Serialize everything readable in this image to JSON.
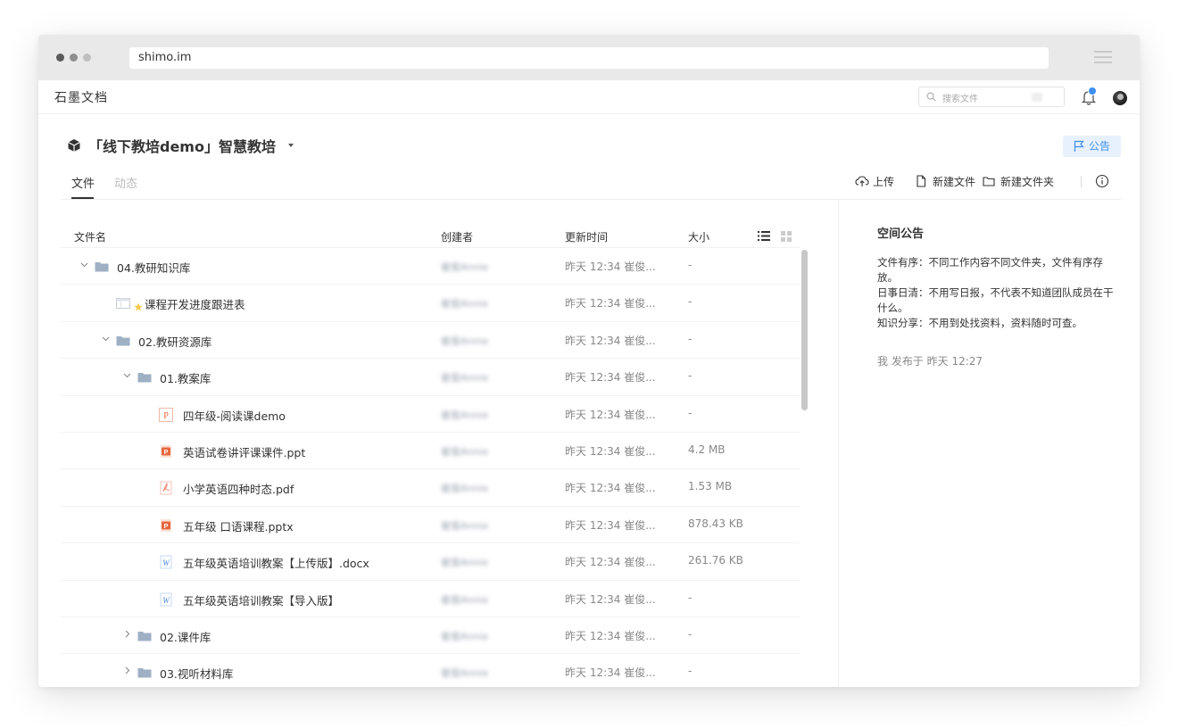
{
  "browser": {
    "url": "shimo.im"
  },
  "app": {
    "brand": "石墨文档",
    "search_placeholder": "搜索文件"
  },
  "team": {
    "title": "「线下教培demo」智慧教培",
    "announce_label": "公告"
  },
  "tabs": [
    {
      "label": "文件"
    },
    {
      "label": "动态"
    }
  ],
  "actions": {
    "upload": "上传",
    "new_file": "新建文件",
    "new_folder": "新建文件夹"
  },
  "columns": {
    "name": "文件名",
    "creator": "创建者",
    "updated": "更新时间",
    "size": "大小"
  },
  "rows": [
    {
      "name": "04.教研知识库",
      "creator": "崔俊Annie",
      "time": "昨天 12:34 崔俊...",
      "size": "-",
      "type": "folder",
      "chevron": "down",
      "depth": 0
    },
    {
      "name": "课程开发进度跟进表",
      "creator": "崔俊Annie",
      "time": "昨天 12:34 崔俊...",
      "size": "-",
      "type": "sheet",
      "chevron": "none",
      "depth": 1
    },
    {
      "name": "02.教研资源库",
      "creator": "崔俊Annie",
      "time": "昨天 12:34 崔俊...",
      "size": "-",
      "type": "folder",
      "chevron": "down",
      "depth": 1
    },
    {
      "name": "01.教案库",
      "creator": "崔俊Annie",
      "time": "昨天 12:34 崔俊...",
      "size": "-",
      "type": "folder",
      "chevron": "down",
      "depth": 2
    },
    {
      "name": "四年级-阅读课demo",
      "creator": "崔俊Annie",
      "time": "昨天 12:34 崔俊...",
      "size": "-",
      "type": "slides",
      "chevron": "none",
      "depth": 3
    },
    {
      "name": "英语试卷讲评课课件.ppt",
      "creator": "崔俊Annie",
      "time": "昨天 12:34 崔俊...",
      "size": "4.2 MB",
      "type": "ppt",
      "chevron": "none",
      "depth": 3
    },
    {
      "name": "小学英语四种时态.pdf",
      "creator": "崔俊Annie",
      "time": "昨天 12:34 崔俊...",
      "size": "1.53 MB",
      "type": "pdf",
      "chevron": "none",
      "depth": 3
    },
    {
      "name": "五年级 口语课程.pptx",
      "creator": "崔俊Annie",
      "time": "昨天 12:34 崔俊...",
      "size": "878.43 KB",
      "type": "ppt",
      "chevron": "none",
      "depth": 3
    },
    {
      "name": "五年级英语培训教案【上传版】.docx",
      "creator": "崔俊Annie",
      "time": "昨天 12:34 崔俊...",
      "size": "261.76 KB",
      "type": "word",
      "chevron": "none",
      "depth": 3
    },
    {
      "name": "五年级英语培训教案【导入版】",
      "creator": "崔俊Annie",
      "time": "昨天 12:34 崔俊...",
      "size": "-",
      "type": "word",
      "chevron": "none",
      "depth": 3
    },
    {
      "name": "02.课件库",
      "creator": "崔俊Annie",
      "time": "昨天 12:34 崔俊...",
      "size": "-",
      "type": "folder",
      "chevron": "right",
      "depth": 2
    },
    {
      "name": "03.视听材料库",
      "creator": "崔俊Annie",
      "time": "昨天 12:34 崔俊...",
      "size": "-",
      "type": "folder",
      "chevron": "right",
      "depth": 2
    }
  ],
  "announcement": {
    "title": "空间公告",
    "lines": [
      "文件有序：不同工作内容不同文件夹，文件有序存放。",
      "日事日清：不用写日报，不代表不知道团队成员在干什么。",
      "知识分享：不用到处找资料，资料随时可查。"
    ],
    "meta": "我 发布于 昨天 12:27"
  },
  "colors": {
    "accent": "#3d8ff0",
    "folder": "#9fb0c4",
    "ppt": "#e8683f",
    "pdf": "#f08a7a",
    "word": "#4a86e8"
  }
}
